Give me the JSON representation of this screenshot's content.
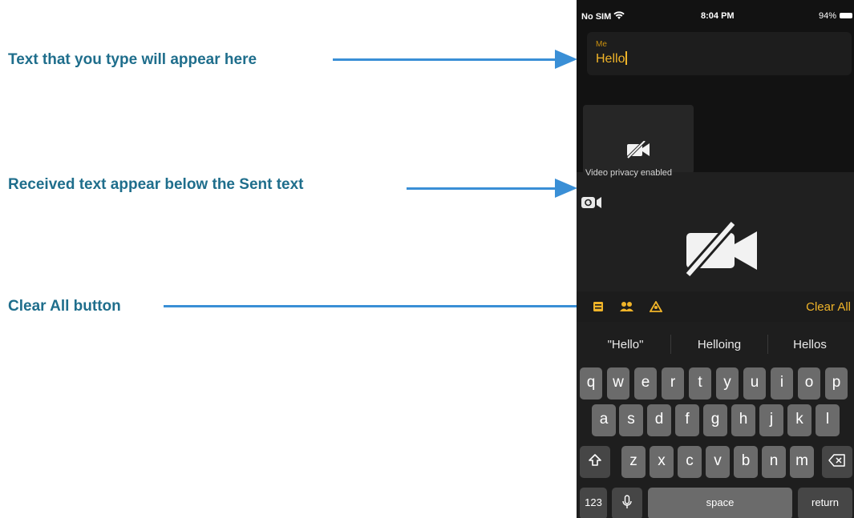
{
  "callouts": {
    "typed_text": "Text that you type will appear here",
    "received_text": "Received text appear below the Sent text",
    "clear_all": "Clear All button"
  },
  "status_bar": {
    "carrier": "No SIM",
    "time": "8:04 PM",
    "battery": "94%"
  },
  "sent_message": {
    "sender": "Me",
    "text": "Hello"
  },
  "video": {
    "privacy_notice": "Video privacy enabled"
  },
  "toolbar": {
    "clear_all_label": "Clear All"
  },
  "suggestions": [
    "\"Hello\"",
    "Helloing",
    "Hellos"
  ],
  "keyboard": {
    "row1": [
      "q",
      "w",
      "e",
      "r",
      "t",
      "y",
      "u",
      "i",
      "o",
      "p"
    ],
    "row2": [
      "a",
      "s",
      "d",
      "f",
      "g",
      "h",
      "j",
      "k",
      "l"
    ],
    "row3": [
      "z",
      "x",
      "c",
      "v",
      "b",
      "n",
      "m"
    ],
    "numbers_key": "123",
    "space_key": "space",
    "return_key": "return"
  },
  "colors": {
    "callout_text": "#1f6e8c",
    "arrow": "#3a8fd6",
    "accent": "#f0b429"
  }
}
